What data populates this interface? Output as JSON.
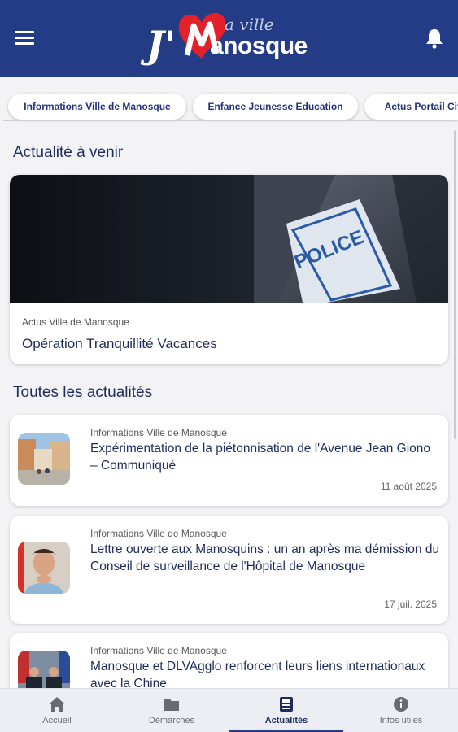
{
  "header": {
    "logo_prefix": "J'",
    "logo_small": "a ville",
    "logo_name": "anosque",
    "brand_color": "#243b86",
    "heart_color": "#e4202b",
    "menu_icon": "menu-icon",
    "notification_icon": "bell-icon"
  },
  "tabs": [
    {
      "label": "Informations Ville de Manosque"
    },
    {
      "label": "Enfance Jeunesse Education"
    },
    {
      "label": "Actus Portail Cito"
    }
  ],
  "sections": {
    "upcoming_title": "Actualité à venir",
    "all_title": "Toutes les actualités"
  },
  "featured": {
    "category": "Actus Ville de Manosque",
    "title": "Opération Tranquillité Vacances",
    "image_text": "POLICE"
  },
  "news": [
    {
      "category": "Informations Ville de Manosque",
      "title": "Expérimentation de la piétonnisation de l'Avenue Jean Giono – Communiqué",
      "date": "11 août 2025"
    },
    {
      "category": "Informations Ville de Manosque",
      "title": "Lettre ouverte aux Manosquins : un an après ma démission du Conseil de surveillance de l'Hôpital de Manosque",
      "date": "17 juil. 2025"
    },
    {
      "category": "Informations Ville de Manosque",
      "title": "Manosque et DLVAgglo renforcent leurs liens internationaux avec la Chine",
      "date": ""
    }
  ],
  "bottom_nav": [
    {
      "label": "Accueil",
      "icon": "home-icon"
    },
    {
      "label": "Démarches",
      "icon": "folder-icon"
    },
    {
      "label": "Actualités",
      "icon": "news-icon",
      "active": true
    },
    {
      "label": "Infos utiles",
      "icon": "info-icon"
    }
  ]
}
